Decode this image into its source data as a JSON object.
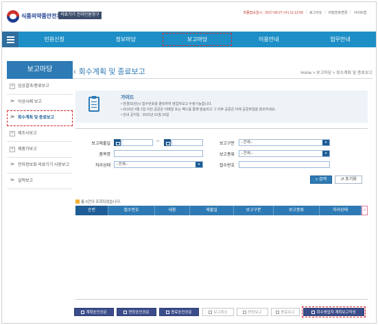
{
  "header": {
    "org_name": "식품의약품안전처",
    "site_badge": "의료기기 전자민원창구",
    "last_login": "최종접속일시 : 2017-09-27 (수) 11:13:59",
    "links": [
      "로그아웃",
      "비밀번호변경",
      "사이트맵"
    ]
  },
  "nav": {
    "items": [
      "민원신청",
      "정보마당",
      "보고마당",
      "이용안내",
      "업무안내"
    ],
    "active_index": 2
  },
  "sidebar": {
    "title": "보고마당",
    "items": [
      {
        "label": "임상결과/종료보고",
        "marker": "+",
        "boxed": true
      },
      {
        "label": "이상사례 보고",
        "marker": "≫",
        "boxed": false
      },
      {
        "label": "회수계획 및 종료보고",
        "marker": "≫",
        "boxed": false,
        "active": true
      },
      {
        "label": "제조사보고",
        "marker": "+",
        "boxed": true
      },
      {
        "label": "제품가보고",
        "marker": "+",
        "boxed": true
      },
      {
        "label": "전자정보화 의료기기 사용보고",
        "marker": "≫",
        "boxed": false
      },
      {
        "label": "실적보고",
        "marker": "≫",
        "boxed": false
      }
    ]
  },
  "page": {
    "title": "회수계획 및 종료보고",
    "breadcrumb": "Home > 보고마당 > 회수계획 및 종료보고"
  },
  "guide": {
    "title": "가이드",
    "lines": [
      "• 변경(보완)시 접수번호를 클릭하여 영업자보고 수정가능합니다.",
      "• 2015년 4월 1일 이전 공문은 이메일 또는 팩스를 통해 발송되고 그 이후 공문은 아래 공문파일을 참조하세요.",
      "• 안내 공지일 : 2015년 01월 15일"
    ]
  },
  "form": {
    "report_date_label": "보고제출일",
    "report_type_label": "보고구분",
    "report_type_value": "--전체--",
    "product_label": "품목명",
    "report_kind_label": "보고종류",
    "report_kind_value": "--전체--",
    "status_label": "처리상태",
    "status_value": "--전체--",
    "receipt_label": "접수번호",
    "tilde": "~",
    "search_label": "검색",
    "reset_label": "초기화"
  },
  "results": {
    "message": "총 0건이 조회되었습니다.",
    "columns": [
      "순번",
      "접수번호",
      "내용",
      "제출일",
      "보고구분",
      "보고종류",
      "처리상태"
    ],
    "scroll_glyph": "≡"
  },
  "actions": [
    {
      "label": "계획승인공문",
      "enabled": true
    },
    {
      "label": "연장승인공문",
      "enabled": true
    },
    {
      "label": "종료승인공문",
      "enabled": true
    },
    {
      "label": "보고취소",
      "enabled": false
    },
    {
      "label": "연장보고",
      "enabled": false
    },
    {
      "label": "종료보고",
      "enabled": false
    },
    {
      "label": "회수영업자 계획보고작성",
      "enabled": true,
      "highlight": true
    }
  ],
  "colors": {
    "nav_blue": "#1e8fc6",
    "title_blue": "#2e7ab4",
    "action_navy": "#3b4c8a",
    "highlight_red": "#e0242c"
  }
}
